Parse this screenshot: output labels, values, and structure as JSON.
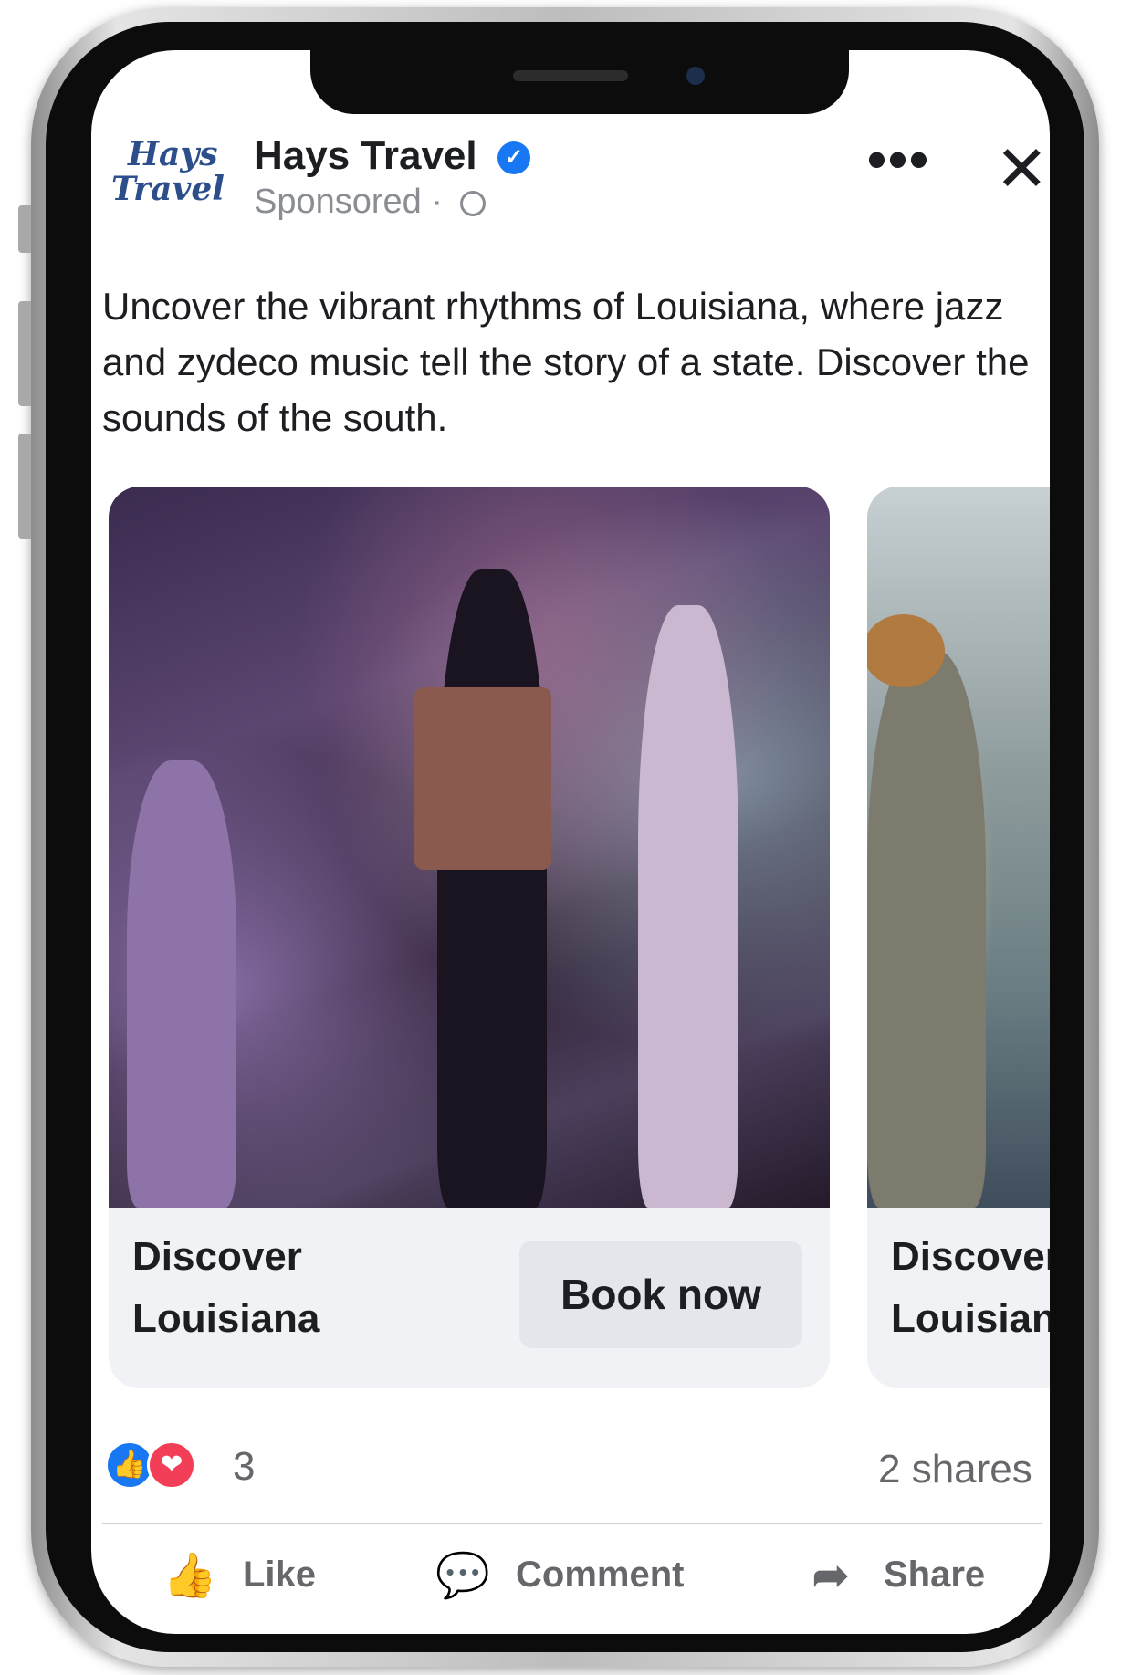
{
  "post": {
    "logo": {
      "line1": "Hays",
      "line2": "Travel"
    },
    "page_name": "Hays Travel",
    "verified_icon": "✓",
    "sponsored": "Sponsored · ",
    "more_icon": "•••",
    "close_icon": "✕",
    "caption": "Uncover the vibrant rhythms of Louisiana, where jazz and zydeco music tell the story of a state. Discover the sounds of the south."
  },
  "carousel": {
    "cards": [
      {
        "title_line1": "Discover",
        "title_line2": "Louisiana",
        "cta": "Book now"
      },
      {
        "title_line1": "Discover",
        "title_line2": "Louisiana"
      }
    ]
  },
  "engagement": {
    "like_reaction_icon": "👍",
    "love_reaction_icon": "❤",
    "reaction_count": "3",
    "shares": "2 shares"
  },
  "actions": {
    "like": {
      "label": "Like",
      "icon": "👍"
    },
    "comment": {
      "label": "Comment",
      "icon": "💬"
    },
    "share": {
      "label": "Share",
      "icon": "➦"
    }
  },
  "colors": {
    "facebook_blue": "#1877f2",
    "love_red": "#f33e58",
    "text_primary": "#1c1e21",
    "text_secondary": "#65676b",
    "button_gray": "#e4e6eb"
  }
}
